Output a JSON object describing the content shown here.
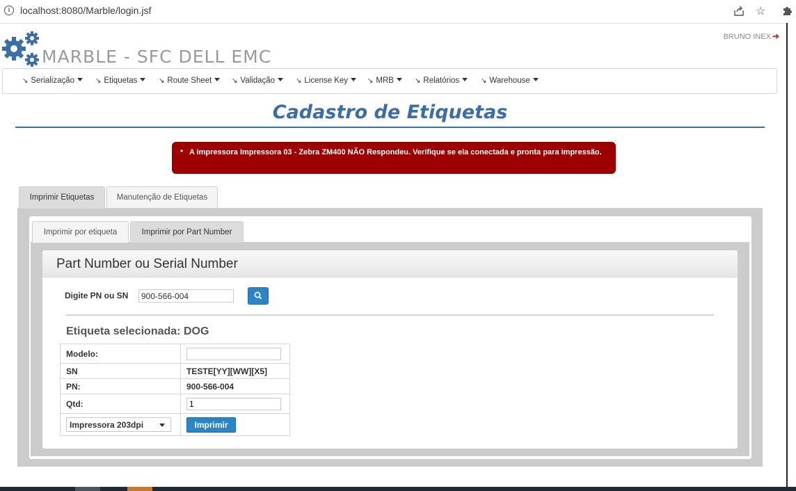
{
  "browser": {
    "url": "localhost:8080/Marble/login.jsf"
  },
  "app": {
    "brand": "MARBLE - SFC DELL EMC",
    "user": "BRUNO INEX"
  },
  "menu": [
    {
      "label": "Serialização"
    },
    {
      "label": "Etiquetas"
    },
    {
      "label": "Route Sheet"
    },
    {
      "label": "Validação"
    },
    {
      "label": "License Key"
    },
    {
      "label": "MRB"
    },
    {
      "label": "Relatórios"
    },
    {
      "label": "Warehouse"
    }
  ],
  "page": {
    "title": "Cadastro de Etiquetas"
  },
  "error": {
    "message": "A impressora Impressora 03 - Zebra ZM400 NÃO Respondeu. Verifique se ela conectada e pronta para impressão."
  },
  "tabs": {
    "outer": [
      "Imprimir Etiquetas",
      "Manutenção de Etiquetas"
    ],
    "inner": [
      "Imprimir por etiqueta",
      "Imprimir por Part Number"
    ]
  },
  "card": {
    "title": "Part Number ou Serial Number",
    "pn_label": "Digite PN ou SN",
    "pn_value": "900-566-004",
    "selected_label": "Etiqueta selecionada: DOG"
  },
  "details": {
    "modelo_label": "Modelo:",
    "modelo_value": "",
    "sn_label": "SN",
    "sn_value": "TESTE[YY][WW][X5]",
    "pn_label": "PN:",
    "pn_value": "900-566-004",
    "qtd_label": "Qtd:",
    "qtd_value": "1",
    "printer_selected": "Impressora 203dpi",
    "print_button": "Imprimir"
  },
  "colors": {
    "accent": "#2a86c9",
    "title": "#3a6eaa",
    "error": "#9c0000"
  }
}
